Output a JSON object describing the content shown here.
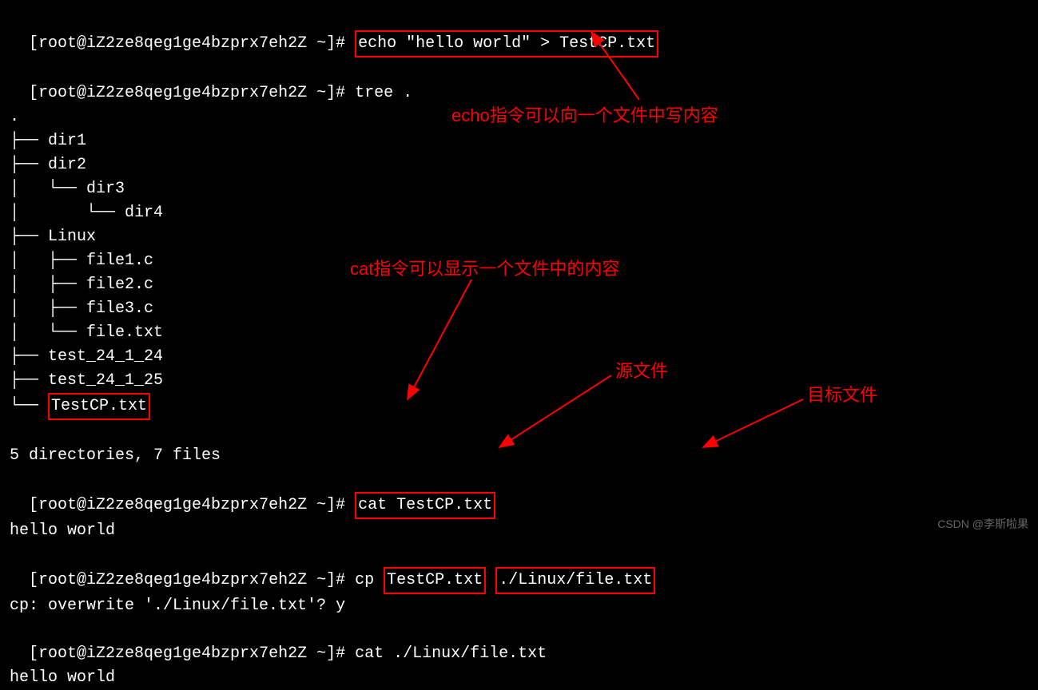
{
  "prompt": "[root@iZ2ze8qeg1ge4bzprx7eh2Z ~]#",
  "commands": {
    "echo": "echo \"hello world\" > TestCP.txt",
    "tree": "tree .",
    "cat1": "cat TestCP.txt",
    "cp": "cp",
    "cp_src": "TestCP.txt",
    "cp_dst": "./Linux/file.txt",
    "overwrite": "cp: overwrite './Linux/file.txt'? y",
    "cat2": "cat ./Linux/file.txt"
  },
  "tree": {
    "dot": ".",
    "dir1": "dir1",
    "dir2": "dir2",
    "dir3": "dir3",
    "dir4": "dir4",
    "linux": "Linux",
    "file1": "file1.c",
    "file2": "file2.c",
    "file3": "file3.c",
    "filetxt": "file.txt",
    "test1": "test_24_1_24",
    "test2": "test_24_1_25",
    "testcp": "TestCP.txt",
    "summary": "5 directories, 7 files"
  },
  "output": {
    "hello1": "hello world",
    "hello2": "hello world"
  },
  "annotations": {
    "echo": "echo指令可以向一个文件中写内容",
    "cat": "cat指令可以显示一个文件中的内容",
    "src": "源文件",
    "dst": "目标文件"
  },
  "watermark": "CSDN @李斯啦果"
}
